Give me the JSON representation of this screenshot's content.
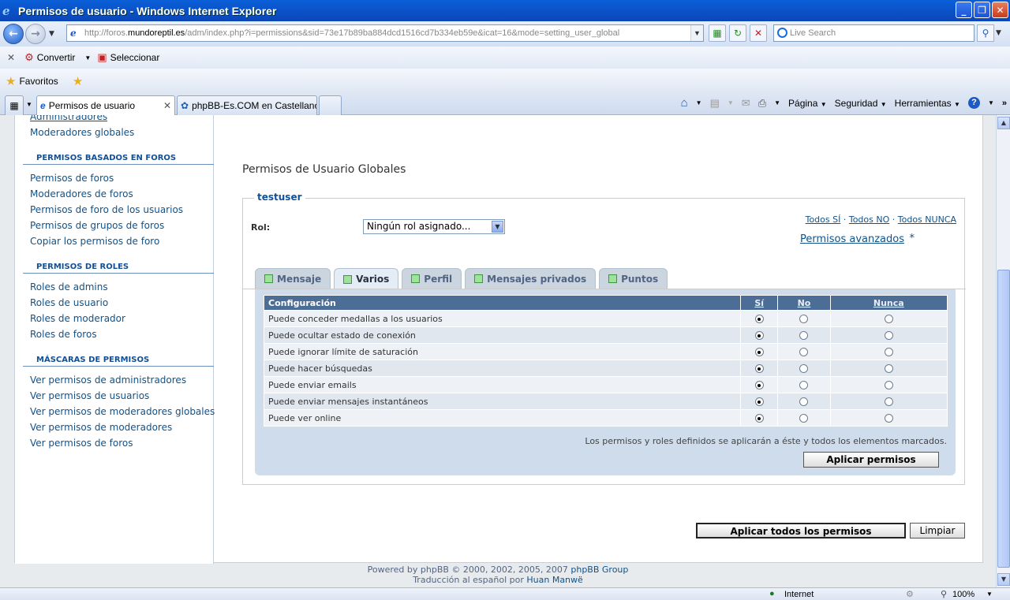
{
  "window": {
    "title": "Permisos de usuario - Windows Internet Explorer",
    "minimize": "_",
    "maximize": "❐",
    "close": "✕"
  },
  "address_bar": {
    "url_prefix": "http://foros.",
    "url_domain": "mundoreptil.es",
    "url_rest": "/adm/index.php?i=permissions&sid=73e17b89ba884dcd1516cd7b334eb59e&icat=16&mode=setting_user_global",
    "search_placeholder": "Live Search"
  },
  "link_bar": {
    "close": "✕",
    "convertir": "Convertir",
    "seleccionar": "Seleccionar"
  },
  "favorites_bar": {
    "favoritos": "Favoritos"
  },
  "browser_tabs": [
    {
      "label": "Permisos de usuario",
      "active": true
    },
    {
      "label": "phpBB-Es.COM en Castellano...",
      "active": false
    }
  ],
  "command_bar": {
    "pagina": "Página",
    "seguridad": "Seguridad",
    "herramientas": "Herramientas"
  },
  "sidebar": {
    "top_items": [
      "Administradores",
      "Moderadores globales"
    ],
    "sections": [
      {
        "title": "PERMISOS BASADOS EN FOROS",
        "items": [
          "Permisos de foros",
          "Moderadores de foros",
          "Permisos de foro de los usuarios",
          "Permisos de grupos de foros",
          "Copiar los permisos de foro"
        ]
      },
      {
        "title": "PERMISOS DE ROLES",
        "items": [
          "Roles de admins",
          "Roles de usuario",
          "Roles de moderador",
          "Roles de foros"
        ]
      },
      {
        "title": "MÁSCARAS DE PERMISOS",
        "items": [
          "Ver permisos de administradores",
          "Ver permisos de usuarios",
          "Ver permisos de moderadores globales",
          "Ver permisos de moderadores",
          "Ver permisos de foros"
        ]
      }
    ]
  },
  "main": {
    "page_title": "Permisos de Usuario Globales",
    "legend": "testuser",
    "rol_label": "Rol:",
    "rol_value": "Ningún rol asignado...",
    "quick_links": {
      "todos_si": "Todos SÍ",
      "todos_no": "Todos NO",
      "todos_nunca": "Todos NUNCA",
      "sep": "·",
      "avanzados": "Permisos avanzados",
      "star": "*"
    },
    "tabs": [
      {
        "label": "Mensaje",
        "active": false
      },
      {
        "label": "Varios",
        "active": true
      },
      {
        "label": "Perfil",
        "active": false
      },
      {
        "label": "Mensajes privados",
        "active": false
      },
      {
        "label": "Puntos",
        "active": false
      }
    ],
    "table": {
      "headers": {
        "config": "Configuración",
        "si": "Sí",
        "no": "No",
        "nunca": "Nunca"
      },
      "rows": [
        {
          "label": "Puede conceder medallas a los usuarios",
          "selected": "si"
        },
        {
          "label": "Puede ocultar estado de conexión",
          "selected": "si"
        },
        {
          "label": "Puede ignorar límite de saturación",
          "selected": "si"
        },
        {
          "label": "Puede hacer búsquedas",
          "selected": "si"
        },
        {
          "label": "Puede enviar emails",
          "selected": "si"
        },
        {
          "label": "Puede enviar mensajes instantáneos",
          "selected": "si"
        },
        {
          "label": "Puede ver online",
          "selected": "si"
        }
      ]
    },
    "note": "Los permisos y roles definidos se aplicarán a éste y todos los elementos marcados.",
    "apply_button": "Aplicar permisos",
    "apply_all_button": "Aplicar todos los permisos",
    "reset_button": "Limpiar"
  },
  "footer": {
    "line1_prefix": "Powered by phpBB © 2000, 2002, 2005, 2007 ",
    "line1_link": "phpBB Group",
    "line2_prefix": "Traducción al español por ",
    "line2_link": "Huan Manwë"
  },
  "status_bar": {
    "zone": "Internet",
    "zoom": "100%"
  }
}
